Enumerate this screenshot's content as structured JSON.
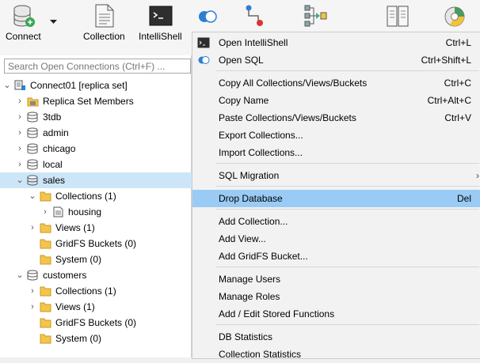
{
  "toolbar": {
    "connect_label": "Connect",
    "collection_label": "Collection",
    "intellishell_label": "IntelliShell"
  },
  "search": {
    "placeholder": "Search Open Connections (Ctrl+F) ..."
  },
  "tree": {
    "connection": "Connect01 [replica set]",
    "replica": "Replica Set Members",
    "db_3tdb": "3tdb",
    "db_admin": "admin",
    "db_chicago": "chicago",
    "db_local": "local",
    "db_sales": "sales",
    "sales_collections": "Collections (1)",
    "sales_housing": "housing",
    "sales_views": "Views (1)",
    "sales_gridfs": "GridFS Buckets (0)",
    "sales_system": "System (0)",
    "db_customers": "customers",
    "cust_collections": "Collections (1)",
    "cust_views": "Views (1)",
    "cust_gridfs": "GridFS Buckets (0)",
    "cust_system": "System (0)"
  },
  "menu": {
    "open_intellishell": "Open IntelliShell",
    "open_intellishell_key": "Ctrl+L",
    "open_sql": "Open SQL",
    "open_sql_key": "Ctrl+Shift+L",
    "copy_all": "Copy All Collections/Views/Buckets",
    "copy_all_key": "Ctrl+C",
    "copy_name": "Copy Name",
    "copy_name_key": "Ctrl+Alt+C",
    "paste": "Paste Collections/Views/Buckets",
    "paste_key": "Ctrl+V",
    "export": "Export Collections...",
    "import": "Import Collections...",
    "sql_migration": "SQL Migration",
    "drop_db": "Drop Database",
    "drop_db_key": "Del",
    "add_collection": "Add Collection...",
    "add_view": "Add View...",
    "add_gridfs": "Add GridFS Bucket...",
    "manage_users": "Manage Users",
    "manage_roles": "Manage Roles",
    "stored_functions": "Add / Edit Stored Functions",
    "db_statistics": "DB Statistics",
    "collection_statistics": "Collection Statistics"
  },
  "colors": {
    "selected_row": "#cde6f7",
    "menu_highlight": "#99cbf5",
    "folder": "#f5c44a"
  }
}
